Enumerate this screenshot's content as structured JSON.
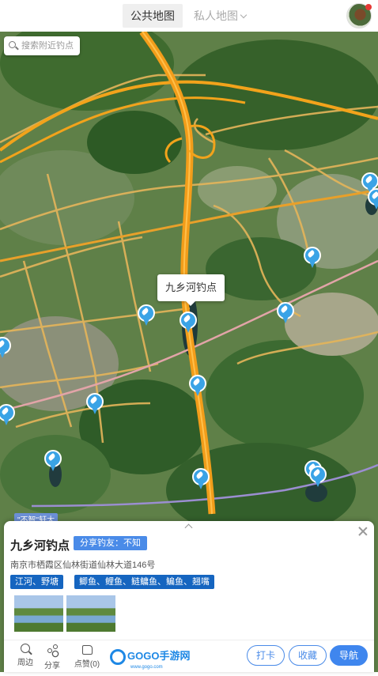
{
  "header": {
    "tab_public": "公共地图",
    "tab_private": "私人地图"
  },
  "map": {
    "search_placeholder": "搜索附近钓点",
    "callout": "九乡河钓点",
    "road_label": "\"不智\"轩大",
    "colors": {
      "highway": "#f29d1a",
      "road": "#e8b24a",
      "marker": "#3aa3e6"
    }
  },
  "spot": {
    "name": "九乡河钓点",
    "share_label": "分享钓友：不知",
    "address": "南京市栖霞区仙林街道仙林大道146号",
    "water_types": "江河、野塘",
    "fish_types": "鲫鱼、鲤鱼、鲢鳙鱼、鳊鱼、翘嘴"
  },
  "actions": {
    "nearby": "周边",
    "share": "分享",
    "like": "点赞(0)",
    "checkin": "打卡",
    "favorite": "收藏",
    "navigate": "导航"
  },
  "watermark": {
    "brand": "GOGO手游网",
    "url": "www.gogo.com"
  }
}
